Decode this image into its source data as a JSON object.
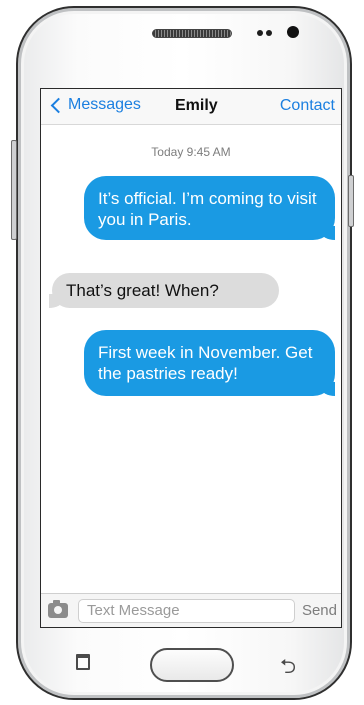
{
  "nav": {
    "back_label": "Messages",
    "title": "Emily",
    "contact_label": "Contact"
  },
  "conversation": {
    "timestamp": "Today 9:45 AM",
    "messages": [
      {
        "direction": "outgoing",
        "text": "It’s official. I’m coming to visit you in Paris."
      },
      {
        "direction": "incoming",
        "text": "That’s great! When?"
      },
      {
        "direction": "outgoing",
        "text": "First week in November. Get the pastries ready!"
      }
    ]
  },
  "composer": {
    "placeholder": "Text Message",
    "send_label": "Send",
    "camera_icon": "camera-icon"
  },
  "hardware": {
    "recent_apps_icon": "recent-apps-icon",
    "home_button": "home-button",
    "back_icon": "back-arrow-icon"
  },
  "colors": {
    "accent": "#1b7fe0",
    "outgoing_bubble": "#1a9ae3",
    "incoming_bubble": "#dcdcdc"
  }
}
